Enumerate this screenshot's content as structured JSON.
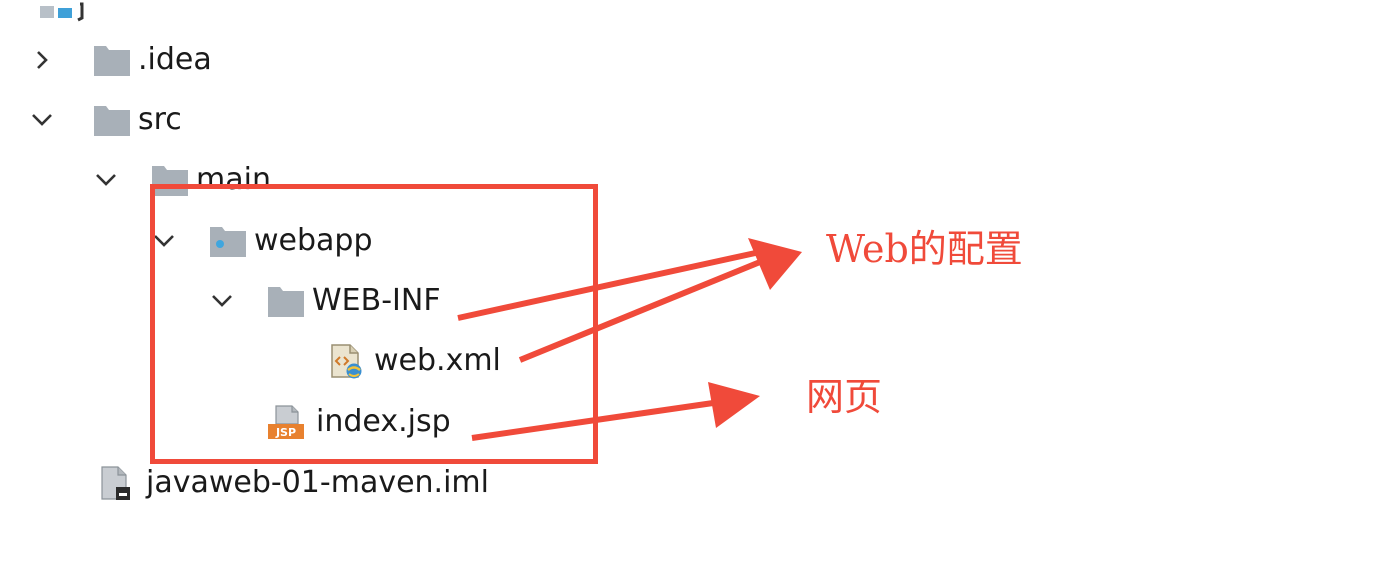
{
  "tree": {
    "items": [
      {
        "label": ".idea",
        "icon": "folder-icon",
        "expanded": false
      },
      {
        "label": "src",
        "icon": "folder-icon",
        "expanded": true
      },
      {
        "label": "main",
        "icon": "folder-icon",
        "expanded": true
      },
      {
        "label": "webapp",
        "icon": "web-folder-icon",
        "expanded": true
      },
      {
        "label": "WEB-INF",
        "icon": "folder-icon",
        "expanded": true
      },
      {
        "label": "web.xml",
        "icon": "xml-config-file-icon"
      },
      {
        "label": "index.jsp",
        "icon": "jsp-file-icon",
        "badge": "JSP"
      },
      {
        "label": "javaweb-01-maven.iml",
        "icon": "iml-file-icon"
      }
    ]
  },
  "annotations": {
    "web_config": "Web的配置",
    "webpage": "网页"
  },
  "colors": {
    "annotation_red": "#f04a3a",
    "folder_gray": "#a8b0b8",
    "jsp_orange": "#e8812f",
    "web_dot_blue": "#40a6de"
  }
}
